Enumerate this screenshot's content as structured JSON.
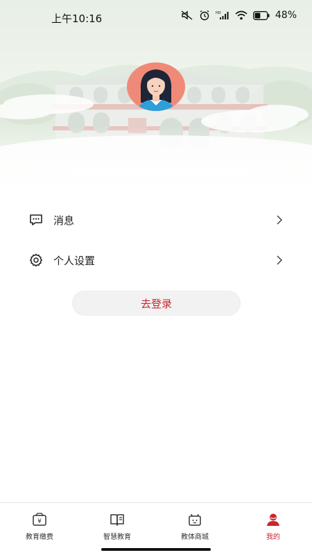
{
  "status_bar": {
    "time": "上午10:16",
    "battery_percent": "48%",
    "battery_level": 0.48,
    "icons": [
      "mute-icon",
      "alarm-icon",
      "hd-signal-icon",
      "wifi-icon",
      "battery-icon"
    ]
  },
  "profile": {
    "avatar_icon": "user-avatar-icon"
  },
  "menu": {
    "items": [
      {
        "label": "消息",
        "icon": "message-icon"
      },
      {
        "label": "个人设置",
        "icon": "gear-icon"
      }
    ]
  },
  "login": {
    "label": "去登录"
  },
  "tabbar": {
    "items": [
      {
        "label": "教育缴费",
        "icon": "payment-icon",
        "active": false
      },
      {
        "label": "智慧教育",
        "icon": "book-icon",
        "active": false
      },
      {
        "label": "教体商城",
        "icon": "shop-icon",
        "active": false
      },
      {
        "label": "我的",
        "icon": "user-icon",
        "active": true
      }
    ]
  },
  "colors": {
    "accent": "#c8262b",
    "hero_top": "#e8efe6",
    "avatar_bg": "#f08a78",
    "tab_inactive": "#333333"
  }
}
